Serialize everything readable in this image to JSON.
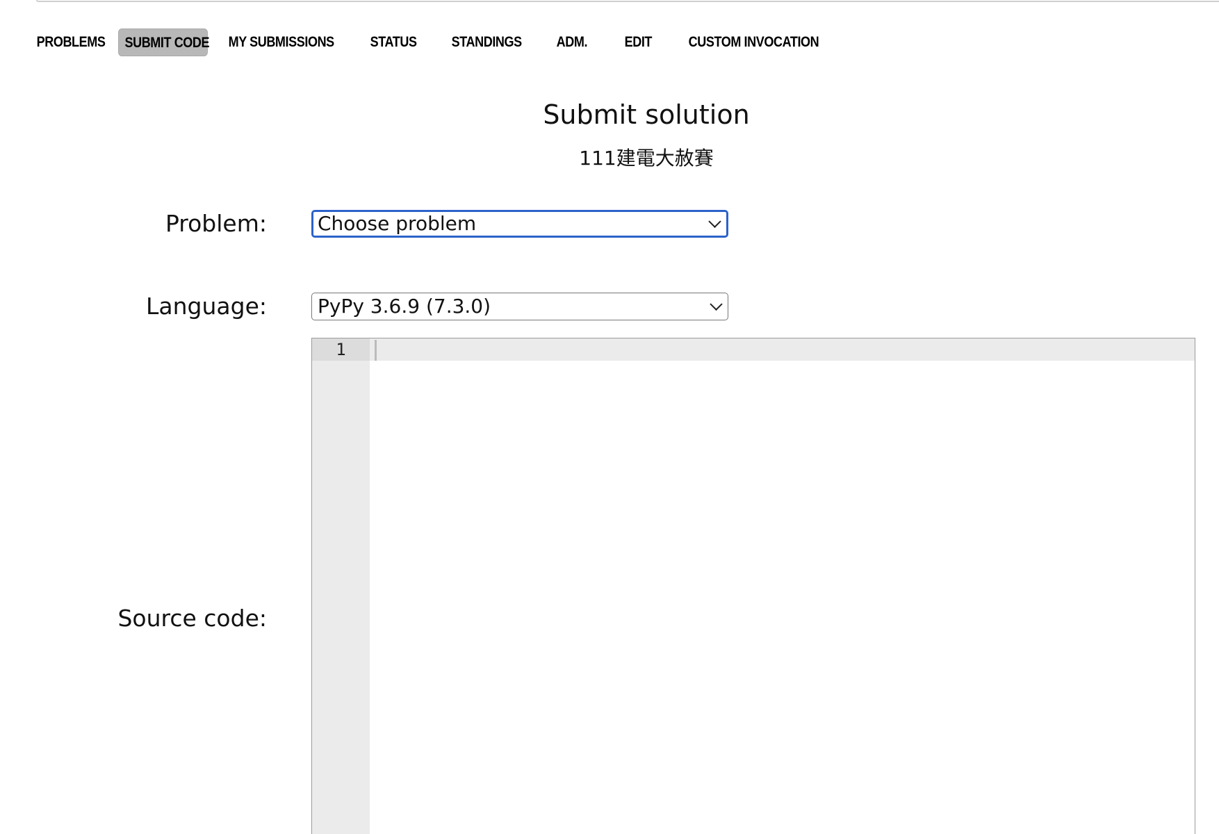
{
  "menu": {
    "items": [
      {
        "label": "PROBLEMS",
        "active": false
      },
      {
        "label": "SUBMIT CODE",
        "active": true
      },
      {
        "label": "MY SUBMISSIONS",
        "active": false
      },
      {
        "label": "STATUS",
        "active": false
      },
      {
        "label": "STANDINGS",
        "active": false
      },
      {
        "label": "ADM.",
        "active": false
      },
      {
        "label": "EDIT",
        "active": false
      },
      {
        "label": "CUSTOM INVOCATION",
        "active": false
      }
    ]
  },
  "page": {
    "title": "Submit solution",
    "subtitle": "111建電大赦賽"
  },
  "form": {
    "problem_label": "Problem:",
    "problem_value": "Choose problem",
    "language_label": "Language:",
    "language_value": "PyPy 3.6.9 (7.3.0)",
    "source_label": "Source code:",
    "editor_line_number": "1"
  }
}
